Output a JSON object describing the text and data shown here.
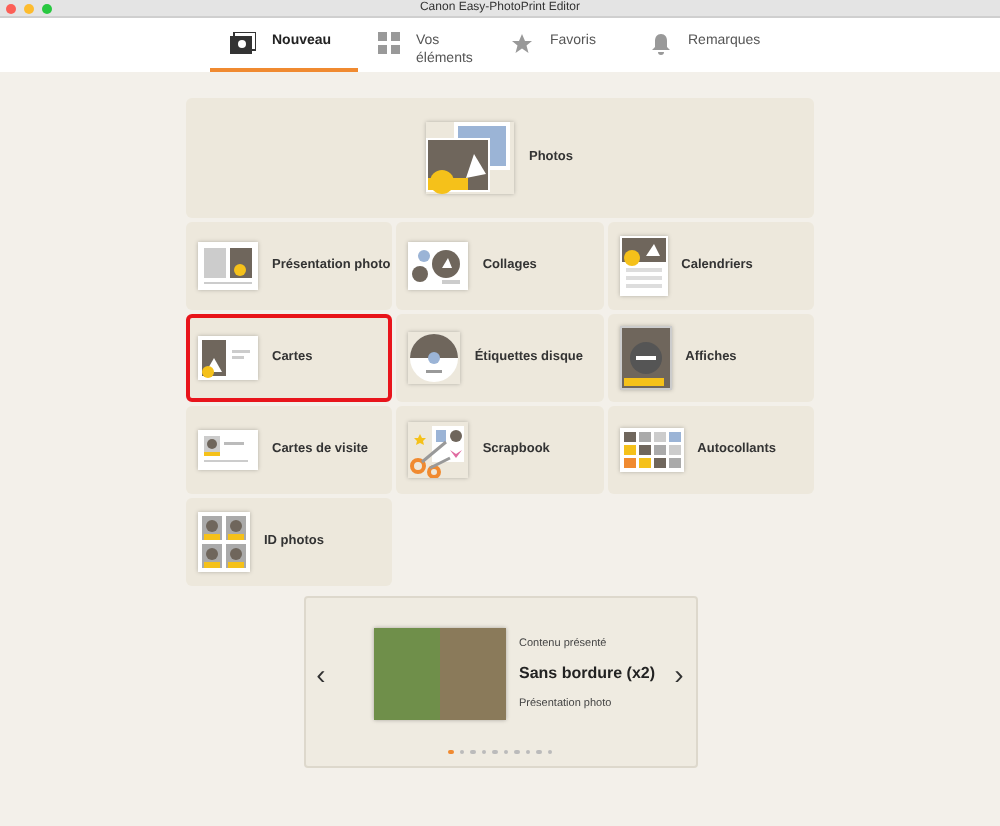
{
  "window": {
    "title": "Canon Easy-PhotoPrint Editor"
  },
  "tabs": [
    {
      "label": "Nouveau",
      "selected": true
    },
    {
      "label": "Vos éléments",
      "selected": false
    },
    {
      "label": "Favoris",
      "selected": false
    },
    {
      "label": "Remarques",
      "selected": false
    }
  ],
  "hero_tile": {
    "label": "Photos",
    "selected": false
  },
  "tiles": [
    {
      "label": "Présentation photo",
      "selected": false
    },
    {
      "label": "Collages",
      "selected": false
    },
    {
      "label": "Calendriers",
      "selected": false
    },
    {
      "label": "Cartes",
      "selected": true
    },
    {
      "label": "Étiquettes disque",
      "selected": false
    },
    {
      "label": "Affiches",
      "selected": false
    },
    {
      "label": "Cartes de visite",
      "selected": false
    },
    {
      "label": "Scrapbook",
      "selected": false
    },
    {
      "label": "Autocollants",
      "selected": false
    },
    {
      "label": "ID photos",
      "selected": false
    }
  ],
  "featured": {
    "heading": "Contenu présenté",
    "title": "Sans bordure (x2)",
    "subtitle": "Présentation photo",
    "prev": "‹",
    "next": "›",
    "dots": [
      {
        "selected": true
      },
      {
        "selected": false
      },
      {
        "selected": false
      },
      {
        "selected": false
      },
      {
        "selected": false
      },
      {
        "selected": false
      },
      {
        "selected": false
      },
      {
        "selected": false
      },
      {
        "selected": false
      },
      {
        "selected": false
      }
    ]
  }
}
